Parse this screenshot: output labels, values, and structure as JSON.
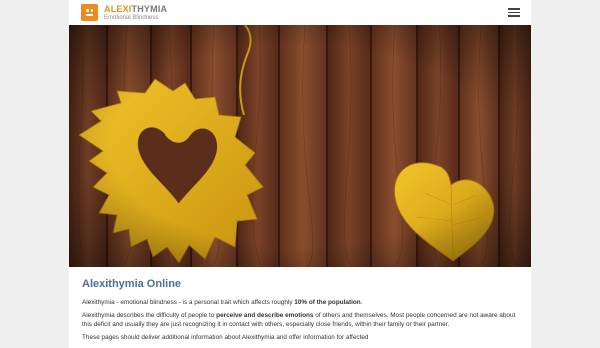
{
  "header": {
    "logo_title_part1": "ALEXI",
    "logo_title_part2": "THYMIA",
    "logo_subtitle": "Emotional Blindness",
    "menu_icon": "hamburger-menu-icon"
  },
  "hero": {
    "description_icon": "wood-background-with-yellow-heart-leaves"
  },
  "content": {
    "title": "Alexithymia Online",
    "p1_before": "Alexithymia - emotional blindness - is a personal trait which affects roughly ",
    "p1_bold": "10% of the population",
    "p1_after": ".",
    "p2_before": "Alexithymia describes the difficulty of people to ",
    "p2_bold": "perceive and describe emotions",
    "p2_after": " of others and themselves. Most people concerned are not aware about this deficit and usually they are just recognizing it in contact with others, especially close friends, within their family or their partner.",
    "p3": "These pages should deliver additional information about Alexithymia and offer information for affected"
  },
  "colors": {
    "accent_orange": "#ef8a1f",
    "title_blue": "#4a6f99",
    "wood": "#6b3a22",
    "leaf": "#e2b21c"
  }
}
